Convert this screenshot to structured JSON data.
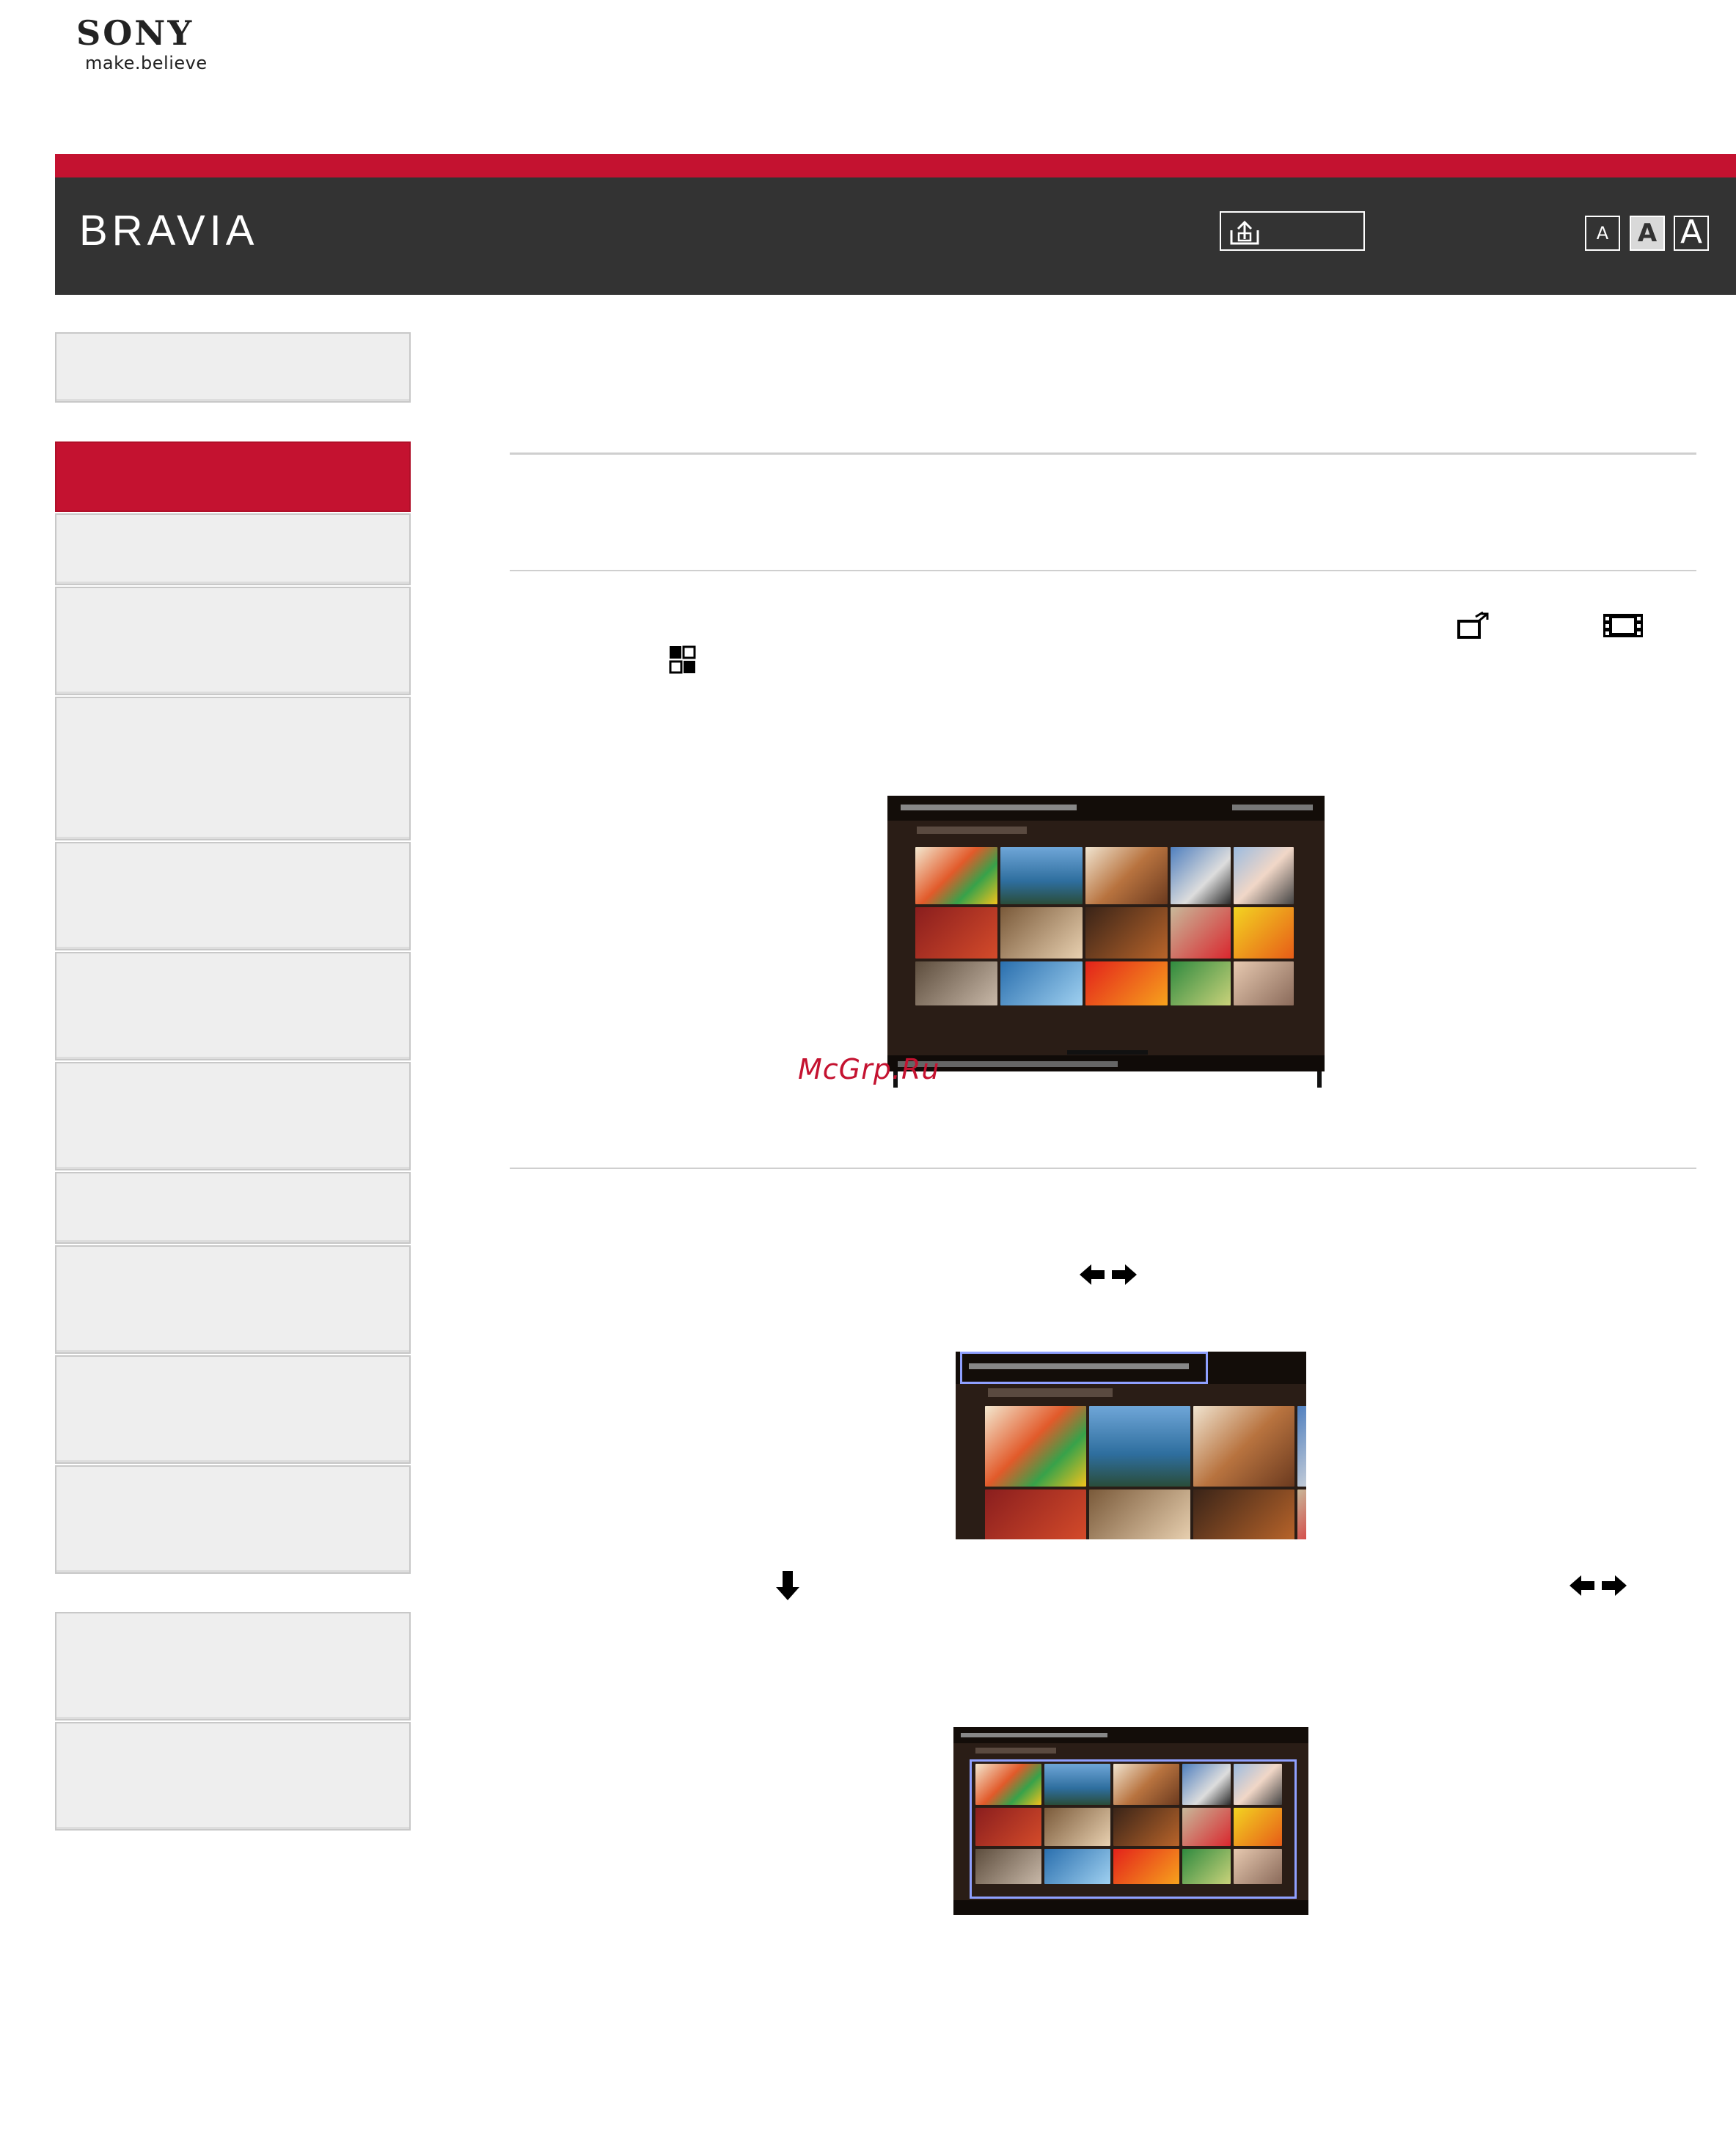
{
  "logo": {
    "brand": "SONY",
    "tagline": "make.believe"
  },
  "header": {
    "product_name": "BRAVIA",
    "print_icon": "print-icon",
    "font_size_buttons": [
      {
        "label": "A",
        "size": "small"
      },
      {
        "label": "A",
        "size": "medium",
        "selected": true
      },
      {
        "label": "A",
        "size": "large"
      }
    ]
  },
  "sidebar": {
    "items": [
      {
        "id": "top",
        "active": false
      },
      {
        "id": "item-1",
        "active": true
      },
      {
        "id": "item-2",
        "active": false
      },
      {
        "id": "item-3",
        "active": false
      },
      {
        "id": "item-4",
        "active": false
      },
      {
        "id": "item-5",
        "active": false
      },
      {
        "id": "item-6",
        "active": false
      },
      {
        "id": "item-7",
        "active": false
      },
      {
        "id": "item-8",
        "active": false
      },
      {
        "id": "item-9",
        "active": false
      },
      {
        "id": "item-10",
        "active": false
      },
      {
        "id": "item-11",
        "active": false
      },
      {
        "id": "bottom-1",
        "active": false
      },
      {
        "id": "bottom-2",
        "active": false
      }
    ]
  },
  "content": {
    "icons": [
      "channel-icon",
      "movies-icon",
      "apps-icon",
      "left-right-arrow-icon",
      "down-arrow-icon",
      "left-right-arrow-icon"
    ],
    "screenshots": [
      {
        "name": "tv-home-menu-screenshot"
      },
      {
        "name": "category-bar-highlighted-screenshot"
      },
      {
        "name": "content-area-highlighted-screenshot"
      }
    ]
  },
  "watermark": "McGrp.Ru",
  "colors": {
    "brand_red": "#c41230",
    "header_dark": "#333333",
    "sidebar_bg": "#eeeeee",
    "highlight_blue": "#8fa0ff"
  }
}
